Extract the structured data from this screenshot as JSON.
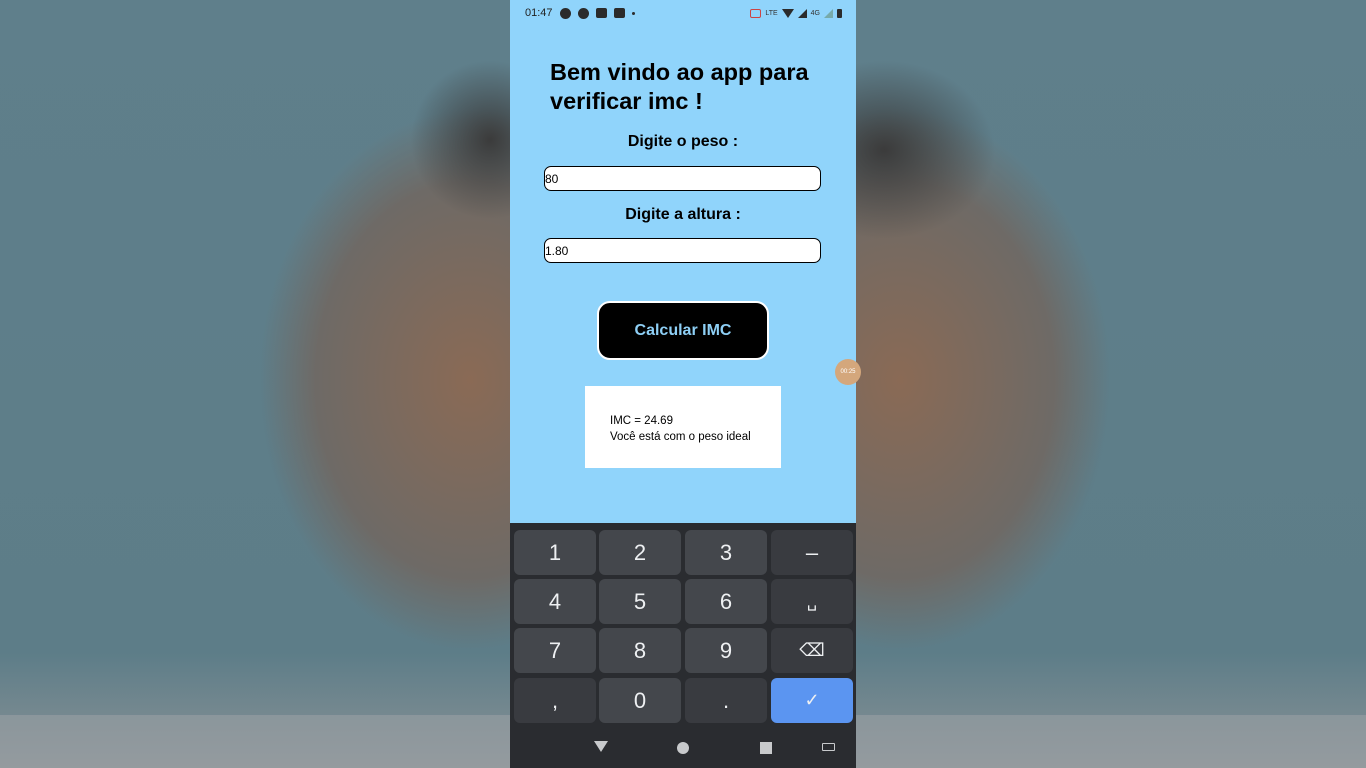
{
  "status_bar": {
    "time": "01:47",
    "right_text": "LTE",
    "network": "4G"
  },
  "app": {
    "title": "Bem vindo ao app para verificar imc !",
    "weight_label": "Digite o peso :",
    "weight_value": "80",
    "height_label": "Digite a altura :",
    "height_value": "1.80",
    "calc_button": "Calcular IMC",
    "result_line1": "IMC = 24.69",
    "result_line2": "Você está com o peso ideal",
    "background_color": "#90d4fb",
    "button_text_color": "#8ecff5"
  },
  "bubble": {
    "text": "00:25"
  },
  "keyboard": {
    "rows": [
      [
        "1",
        "2",
        "3",
        "–"
      ],
      [
        "4",
        "5",
        "6",
        "␣"
      ],
      [
        "7",
        "8",
        "9",
        "⌫"
      ],
      [
        ",",
        "0",
        ".",
        "✓"
      ]
    ],
    "icons": {
      "space": "space-icon",
      "backspace": "backspace-icon",
      "enter": "checkmark-icon"
    }
  },
  "navigation": {
    "icons": [
      "back-icon",
      "home-icon",
      "recents-icon",
      "keyboard-switch-icon"
    ]
  }
}
